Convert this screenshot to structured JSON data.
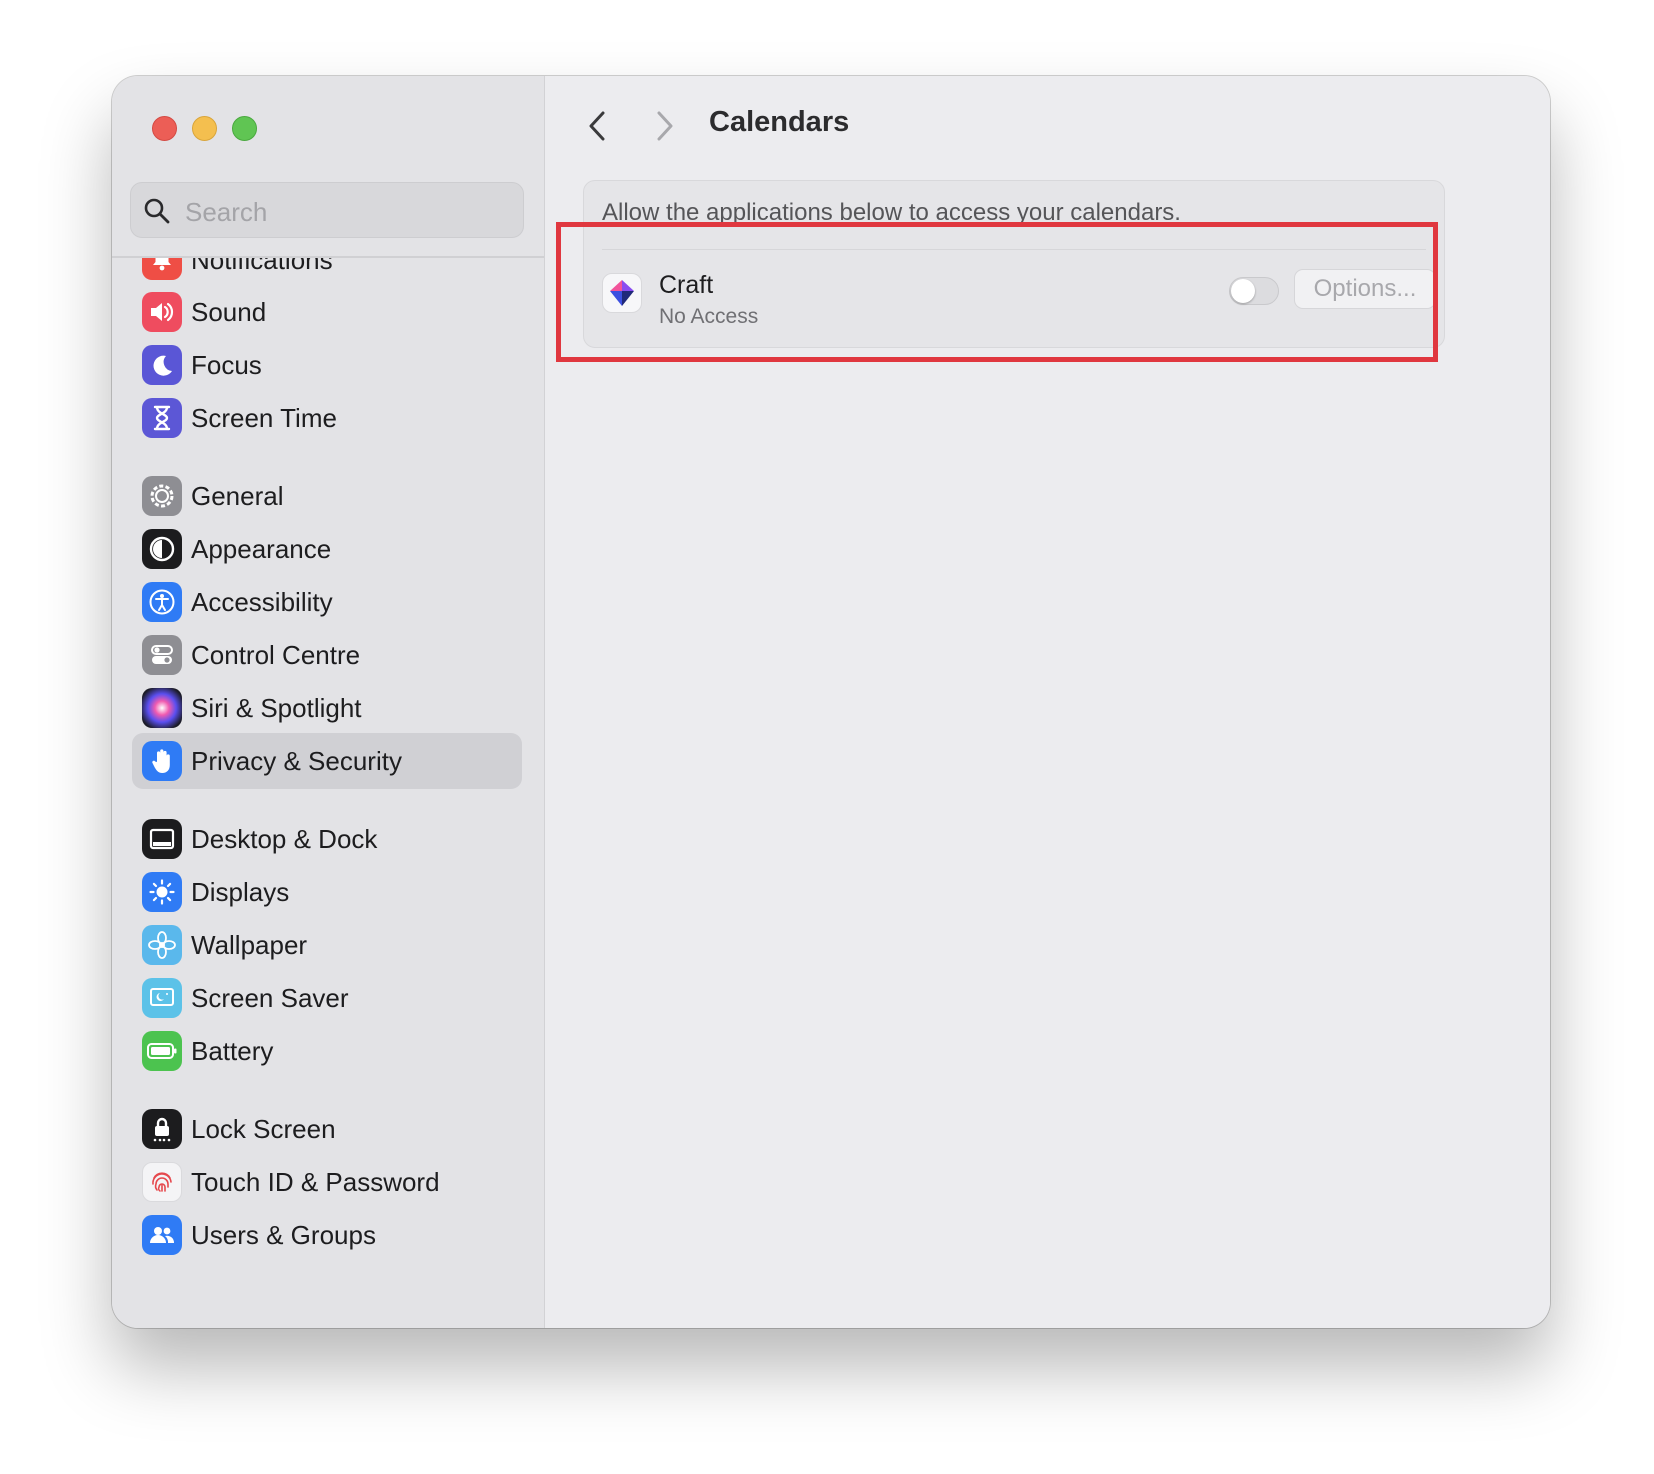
{
  "window": {
    "title": "Calendars"
  },
  "sidebar": {
    "search_placeholder": "Search",
    "items": [
      {
        "label": "Notifications",
        "icon": "bell-icon",
        "color": "#ef4e45"
      },
      {
        "label": "Sound",
        "icon": "speaker-icon",
        "color": "#ef4c5f"
      },
      {
        "label": "Focus",
        "icon": "moon-icon",
        "color": "#5a56d6"
      },
      {
        "label": "Screen Time",
        "icon": "hourglass-icon",
        "color": "#5c57d6"
      },
      {
        "label": "General",
        "icon": "gear-icon",
        "color": "#8e8e93"
      },
      {
        "label": "Appearance",
        "icon": "appearance-icon",
        "color": "#1c1c1e"
      },
      {
        "label": "Accessibility",
        "icon": "accessibility-icon",
        "color": "#2f7bf5"
      },
      {
        "label": "Control Centre",
        "icon": "control-centre-icon",
        "color": "#8e8e93"
      },
      {
        "label": "Siri & Spotlight",
        "icon": "siri-icon",
        "color": "#2a2a3a"
      },
      {
        "label": "Privacy & Security",
        "icon": "hand-icon",
        "color": "#2f7bf5",
        "selected": true
      },
      {
        "label": "Desktop & Dock",
        "icon": "dock-icon",
        "color": "#1c1c1e"
      },
      {
        "label": "Displays",
        "icon": "sun-icon",
        "color": "#2f7bf5"
      },
      {
        "label": "Wallpaper",
        "icon": "flower-icon",
        "color": "#5ab8ec"
      },
      {
        "label": "Screen Saver",
        "icon": "screen-saver-icon",
        "color": "#5cc2e8"
      },
      {
        "label": "Battery",
        "icon": "battery-icon",
        "color": "#4cc34f"
      },
      {
        "label": "Lock Screen",
        "icon": "lock-icon",
        "color": "#1c1c1e"
      },
      {
        "label": "Touch ID & Password",
        "icon": "fingerprint-icon",
        "color": "#f4f4f6"
      },
      {
        "label": "Users & Groups",
        "icon": "users-icon",
        "color": "#2f7bf5"
      }
    ]
  },
  "main": {
    "description": "Allow the applications below to access your calendars.",
    "apps": [
      {
        "name": "Craft",
        "status": "No Access",
        "enabled": false,
        "options_label": "Options..."
      }
    ]
  },
  "colors": {
    "highlight": "#e0373f",
    "accent": "#2f7bf5"
  }
}
